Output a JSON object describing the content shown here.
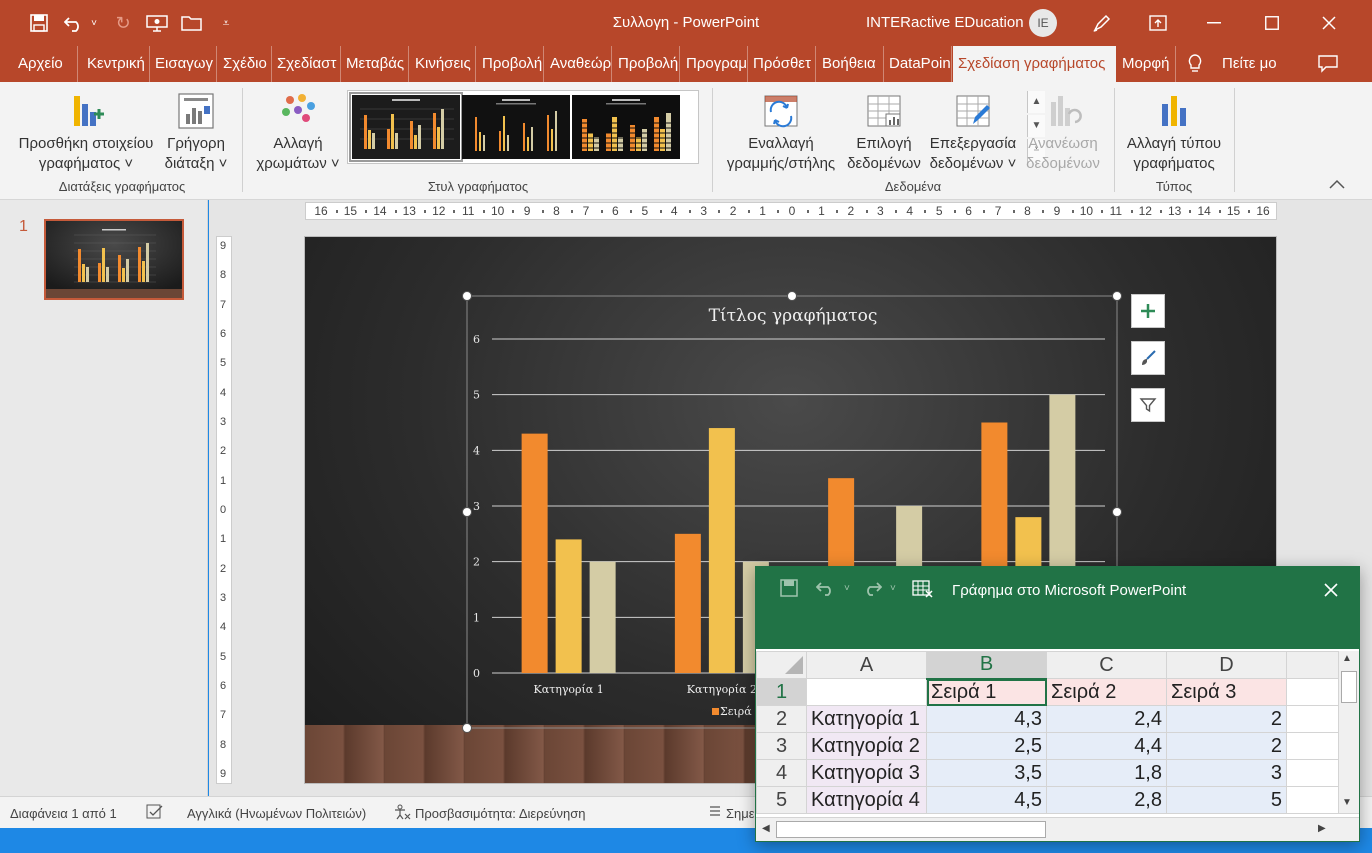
{
  "app": {
    "doc_title": "Συλλογη  -  PowerPoint",
    "user_name": "INTERactive EDucation",
    "user_initials": "IE"
  },
  "tabs": [
    "Αρχείο",
    "Κεντρική",
    "Εισαγωγ",
    "Σχέδιο",
    "Σχεδίαστ",
    "Μεταβάς",
    "Κινήσεις",
    "Προβολή",
    "Αναθεώρ",
    "Προβολή",
    "Προγραμ",
    "Πρόσθετ",
    "Βοήθεια",
    "DataPoin",
    "Σχεδίαση γραφήματος",
    "Μορφή",
    "Πείτε μο"
  ],
  "ribbon": {
    "add_element": [
      "Προσθήκη στοιχείου",
      "γραφήματος ˅"
    ],
    "quick_layout": [
      "Γρήγορη",
      "διάταξη ˅"
    ],
    "change_colors": [
      "Αλλαγή",
      "χρωμάτων ˅"
    ],
    "switch_row_col": [
      "Εναλλαγή",
      "γραμμής/στήλης"
    ],
    "select_data": [
      "Επιλογή",
      "δεδομένων"
    ],
    "edit_data": [
      "Επεξεργασία",
      "δεδομένων ˅"
    ],
    "refresh_data": [
      "Ανανέωση",
      "δεδομένων"
    ],
    "change_type": [
      "Αλλαγή τύπου",
      "γραφήματος"
    ],
    "groups": {
      "layouts": "Διατάξεις γραφήματος",
      "styles": "Στυλ γραφήματος",
      "data": "Δεδομένα",
      "type": "Τύπος"
    }
  },
  "slide_pane": {
    "slide_number": "1"
  },
  "rulers": {
    "horizontal": [
      "16",
      "15",
      "14",
      "13",
      "12",
      "11",
      "10",
      "9",
      "8",
      "7",
      "6",
      "5",
      "4",
      "3",
      "2",
      "1",
      "0",
      "1",
      "2",
      "3",
      "4",
      "5",
      "6",
      "7",
      "8",
      "9",
      "10",
      "11",
      "12",
      "13",
      "14",
      "15",
      "16"
    ],
    "vertical": [
      "9",
      "8",
      "7",
      "6",
      "5",
      "4",
      "3",
      "2",
      "1",
      "0",
      "1",
      "2",
      "3",
      "4",
      "5",
      "6",
      "7",
      "8",
      "9"
    ]
  },
  "chart_data": {
    "type": "bar",
    "title": "Τίτλος γραφήματος",
    "categories": [
      "Κατηγορία 1",
      "Κατηγορία 2",
      "Κατηγορία 3",
      "Κατηγορία 4"
    ],
    "series": [
      {
        "name": "Σειρά 1",
        "values": [
          4.3,
          2.5,
          3.5,
          4.5
        ],
        "color": "#f28a2e"
      },
      {
        "name": "Σειρά 2",
        "values": [
          2.4,
          4.4,
          1.8,
          2.8
        ],
        "color": "#f2c14e"
      },
      {
        "name": "Σειρά 3",
        "values": [
          2,
          2,
          3,
          5
        ],
        "color": "#d4cca5"
      }
    ],
    "yticks": [
      "0",
      "1",
      "2",
      "3",
      "4",
      "5",
      "6"
    ],
    "ylim": [
      0,
      6
    ],
    "grid": true,
    "legend": "bottom",
    "visible_legend_text": "Σειρά 1"
  },
  "statusbar": {
    "slide_info": "Διαφάνεια 1 από 1",
    "language": "Αγγλικά (Ηνωμένων Πολιτειών)",
    "accessibility": "Προσβασιμότητα: Διερεύνηση",
    "notes": "Σημει"
  },
  "excel": {
    "title": "Γράφημα στο Microsoft PowerPoint",
    "columns": [
      "A",
      "B",
      "C",
      "D"
    ],
    "rows": [
      {
        "num": "1",
        "cells": [
          "",
          "Σειρά 1",
          "Σειρά 2",
          "Σειρά 3"
        ]
      },
      {
        "num": "2",
        "cells": [
          "Κατηγορία 1",
          "4,3",
          "2,4",
          "2"
        ]
      },
      {
        "num": "3",
        "cells": [
          "Κατηγορία 2",
          "2,5",
          "4,4",
          "2"
        ]
      },
      {
        "num": "4",
        "cells": [
          "Κατηγορία 3",
          "3,5",
          "1,8",
          "3"
        ]
      },
      {
        "num": "5",
        "cells": [
          "Κατηγορία 4",
          "4,5",
          "2,8",
          "5"
        ]
      }
    ]
  }
}
